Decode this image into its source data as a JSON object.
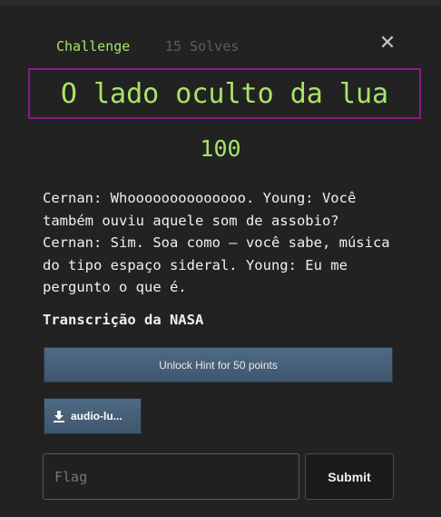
{
  "tabs": {
    "challenge": "Challenge",
    "solves": "15 Solves"
  },
  "close_symbol": "✕",
  "challenge": {
    "title": "O lado oculto da lua",
    "points": "100",
    "description": "Cernan: Whoooooooooooooo. Young: Você também ouviu aquele som de assobio? Cernan: Sim. Soa como – você sabe, música do tipo espaço sideral. Young: Eu me pergunto o que é.",
    "source": "Transcrição da NASA"
  },
  "hint_button": "Unlock Hint for 50 points",
  "file": {
    "label": "audio-lu...",
    "icon": "download-icon"
  },
  "flag_input": {
    "placeholder": "Flag",
    "value": ""
  },
  "submit_label": "Submit",
  "colors": {
    "accent_green": "#a8e468",
    "title_border": "#8a1a8a",
    "button_blue": "#4a6580",
    "background": "#222222"
  }
}
